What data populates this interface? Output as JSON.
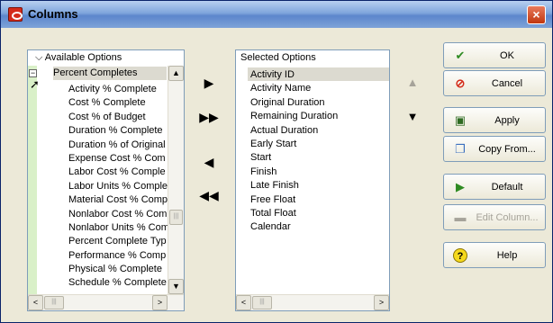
{
  "window": {
    "title": "Columns",
    "close_label": "×"
  },
  "available": {
    "header": "Available Options",
    "group_label": "Percent Completes",
    "items": [
      "Activity % Complete",
      "Cost % Complete",
      "Cost % of Budget",
      "Duration % Complete",
      "Duration % of Original",
      "Expense Cost % Com",
      "Labor Cost % Comple",
      "Labor Units % Comple",
      "Material Cost % Comp",
      "Nonlabor Cost % Com",
      "Nonlabor Units % Com",
      "Percent Complete Typ",
      "Performance % Comp",
      "Physical % Complete",
      "Schedule % Complete"
    ]
  },
  "selected": {
    "header": "Selected Options",
    "items": [
      "Activity ID",
      "Activity Name",
      "Original Duration",
      "Remaining Duration",
      "Actual Duration",
      "Early Start",
      "Start",
      "Finish",
      "Late Finish",
      "Free Float",
      "Total Float",
      "Calendar"
    ]
  },
  "move_buttons": {
    "add": "▶",
    "add_all": "▶▶",
    "remove": "◀",
    "remove_all": "◀◀"
  },
  "order_buttons": {
    "up": "▲",
    "down": "▼"
  },
  "actions": {
    "ok": {
      "label": "OK",
      "icon": "check-icon",
      "glyph": "✔",
      "color": "#2e8b22"
    },
    "cancel": {
      "label": "Cancel",
      "icon": "cancel-icon",
      "glyph": "⊘",
      "color": "#d42b1a"
    },
    "apply": {
      "label": "Apply",
      "icon": "apply-icon",
      "glyph": "▣",
      "color": "#2e6b22"
    },
    "copy_from": {
      "label": "Copy From...",
      "icon": "copy-icon",
      "glyph": "❐",
      "color": "#3a6fbf"
    },
    "default": {
      "label": "Default",
      "icon": "default-icon",
      "glyph": "▶",
      "color": "#2e8b22"
    },
    "edit_column": {
      "label": "Edit Column...",
      "icon": "edit-column-icon",
      "glyph": "▬",
      "color": "#a6a39a"
    },
    "help": {
      "label": "Help",
      "icon": "help-icon",
      "glyph": "?",
      "color": "#c9a400"
    }
  },
  "scroll": {
    "left": "<",
    "right": ">",
    "up": "^",
    "down": "v",
    "grip": "|||"
  }
}
